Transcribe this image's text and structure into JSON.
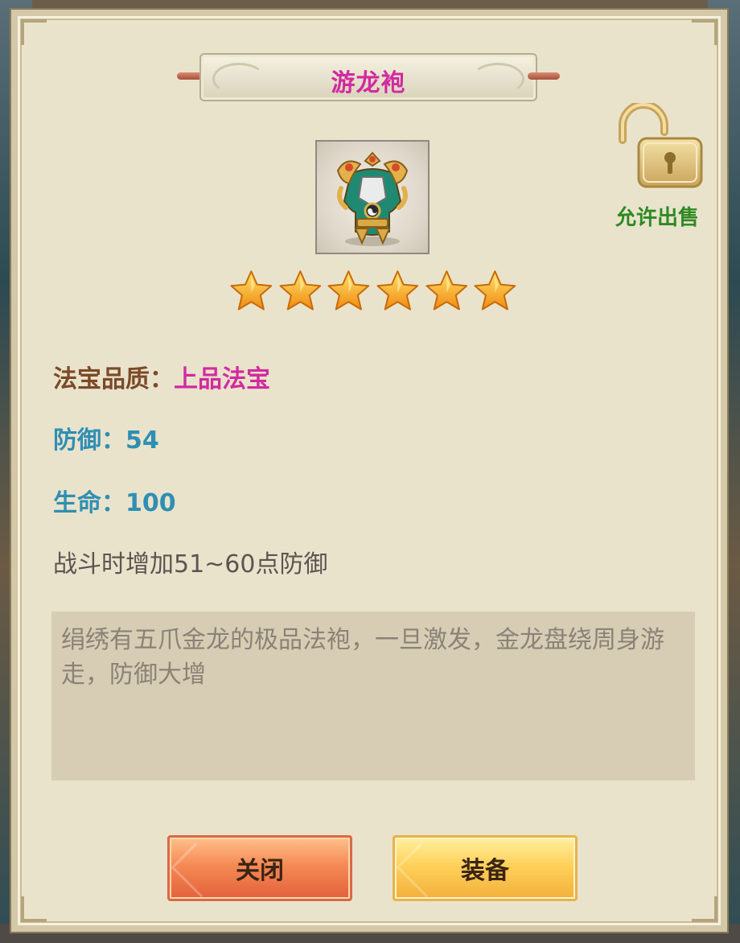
{
  "title": "游龙袍",
  "item": {
    "icon": "dragon-armor-icon",
    "stars": 6
  },
  "sell_status": {
    "label": "允许出售",
    "icon": "unlocked-padlock-icon"
  },
  "attributes": {
    "quality_label": "法宝品质：",
    "quality_value": "上品法宝",
    "defense": "防御：54",
    "health": "生命：100",
    "effect": "战斗时增加51~60点防御"
  },
  "description": "绢绣有五爪金龙的极品法袍，一旦激发，金龙盘绕周身游走，防御大增",
  "buttons": {
    "close": "关闭",
    "equip": "装备"
  },
  "colors": {
    "title": "#d22aa0",
    "quality_value": "#d22aa0",
    "stat": "#2f8fb3",
    "sell_label": "#2d8a23"
  }
}
